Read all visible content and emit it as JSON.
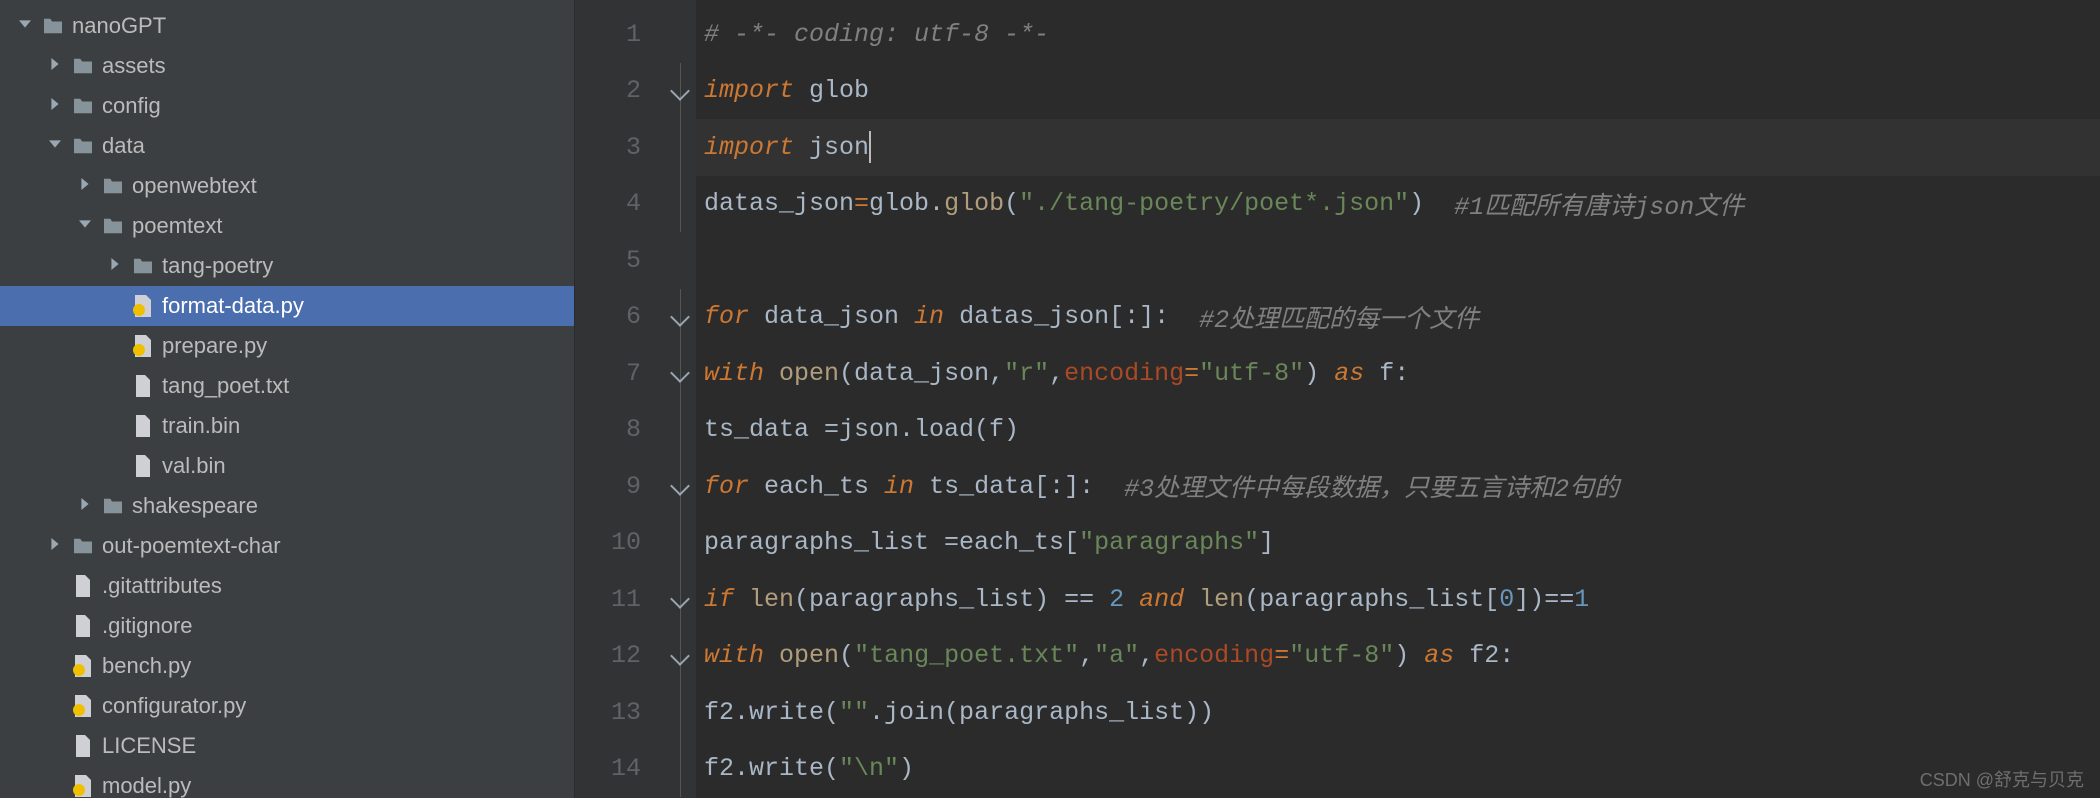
{
  "tree": [
    {
      "indent": 0,
      "chev": "down",
      "icon": "folder",
      "root": true,
      "dn": "tree-nanogpt",
      "label": "nanoGPT"
    },
    {
      "indent": 1,
      "chev": "right",
      "icon": "folder",
      "dn": "tree-assets",
      "label": "assets"
    },
    {
      "indent": 1,
      "chev": "right",
      "icon": "folder",
      "dn": "tree-config",
      "label": "config"
    },
    {
      "indent": 1,
      "chev": "down",
      "icon": "folder",
      "dn": "tree-data",
      "label": "data"
    },
    {
      "indent": 2,
      "chev": "right",
      "icon": "folder",
      "dn": "tree-openwebtext",
      "label": "openwebtext"
    },
    {
      "indent": 2,
      "chev": "down",
      "icon": "folder",
      "dn": "tree-poemtext",
      "label": "poemtext"
    },
    {
      "indent": 3,
      "chev": "right",
      "icon": "folder",
      "dn": "tree-tang-poetry",
      "label": "tang-poetry"
    },
    {
      "indent": 3,
      "chev": "",
      "icon": "pyfile",
      "dn": "tree-format-data",
      "label": "format-data.py",
      "selected": true
    },
    {
      "indent": 3,
      "chev": "",
      "icon": "pyfile",
      "dn": "tree-prepare",
      "label": "prepare.py"
    },
    {
      "indent": 3,
      "chev": "",
      "icon": "txtfile",
      "dn": "tree-tang-poet",
      "label": "tang_poet.txt"
    },
    {
      "indent": 3,
      "chev": "",
      "icon": "bin",
      "dn": "tree-train-bin",
      "label": "train.bin"
    },
    {
      "indent": 3,
      "chev": "",
      "icon": "bin",
      "dn": "tree-val-bin",
      "label": "val.bin"
    },
    {
      "indent": 2,
      "chev": "right",
      "icon": "folder",
      "dn": "tree-shakespeare",
      "label": "shakespeare"
    },
    {
      "indent": 1,
      "chev": "right",
      "icon": "folder",
      "dn": "tree-out-poemtext-char",
      "label": "out-poemtext-char"
    },
    {
      "indent": 1,
      "chev": "",
      "icon": "gen",
      "dn": "tree-gitattributes",
      "label": ".gitattributes"
    },
    {
      "indent": 1,
      "chev": "",
      "icon": "gen",
      "dn": "tree-gitignore",
      "label": ".gitignore"
    },
    {
      "indent": 1,
      "chev": "",
      "icon": "pyfile",
      "dn": "tree-bench",
      "label": "bench.py"
    },
    {
      "indent": 1,
      "chev": "",
      "icon": "pyfile",
      "dn": "tree-configurator",
      "label": "configurator.py"
    },
    {
      "indent": 1,
      "chev": "",
      "icon": "gen",
      "dn": "tree-license",
      "label": "LICENSE"
    },
    {
      "indent": 1,
      "chev": "",
      "icon": "pyfile",
      "dn": "tree-model",
      "label": "model.py"
    }
  ],
  "gutter": [
    "1",
    "2",
    "3",
    "4",
    "5",
    "6",
    "7",
    "8",
    "9",
    "10",
    "11",
    "12",
    "13",
    "14"
  ],
  "fold": [
    "",
    "mark",
    "line",
    "line",
    "",
    "mark",
    "mark",
    "line",
    "mark",
    "line",
    "mark",
    "mark",
    "line",
    "line"
  ],
  "code": {
    "l1_comment": "# -*- coding: utf-8 -*-",
    "l2_import": "import",
    "l2_mod": " glob",
    "l3_import": "import",
    "l3_mod": " json",
    "l4_a": "datas_json",
    "l4_eq": "=",
    "l4_b": "glob.",
    "l4_fn": "glob",
    "l4_c": "(",
    "l4_str": "\"./tang-poetry/poet*.json\"",
    "l4_d": ") ",
    "l4_cmt": " #1匹配所有唐诗json文件",
    "l6_for": "for",
    "l6_a": " data_json ",
    "l6_in": "in",
    "l6_b": " datas_json[:]: ",
    "l6_cmt": " #2处理匹配的每一个文件",
    "l7_with": "with",
    "l7_a": " ",
    "l7_open": "open",
    "l7_b": "(data_json,",
    "l7_s1": "\"r\"",
    "l7_c": ",",
    "l7_enc": "encoding",
    "l7_d": "=",
    "l7_s2": "\"utf-8\"",
    "l7_e": ") ",
    "l7_as": "as",
    "l7_f": " f:",
    "l8_a": "ts_data =json.load(f)",
    "l9_for": "for",
    "l9_a": " each_ts ",
    "l9_in": "in",
    "l9_b": " ts_data[:]: ",
    "l9_cmt": " #3处理文件中每段数据，只要五言诗和2句的",
    "l10_a": "paragraphs_list =each_ts[",
    "l10_s": "\"paragraphs\"",
    "l10_b": "]",
    "l11_if": "if",
    "l11_a": " ",
    "l11_len": "len",
    "l11_b": "(paragraphs_list) == ",
    "l11_n2": "2",
    "l11_c": " ",
    "l11_and": "and",
    "l11_d": " ",
    "l11_len2": "len",
    "l11_e": "(paragraphs_list[",
    "l11_n0": "0",
    "l11_f": "])==",
    "l11_n12": "1",
    "l12_with": "with",
    "l12_a": " ",
    "l12_open": "open",
    "l12_b": "(",
    "l12_s1": "\"tang_poet.txt\"",
    "l12_c": ",",
    "l12_s2": "\"a\"",
    "l12_d": ",",
    "l12_enc": "encoding",
    "l12_e": "=",
    "l12_s3": "\"utf-8\"",
    "l12_f": ") ",
    "l12_as": "as",
    "l12_g": " f2:",
    "l13_a": "f2.write(",
    "l13_s": "\"\"",
    "l13_b": ".join(paragraphs_list))",
    "l14_a": "f2.write(",
    "l14_s": "\"\\n\"",
    "l14_b": ")"
  },
  "watermark": "CSDN @舒克与贝克"
}
